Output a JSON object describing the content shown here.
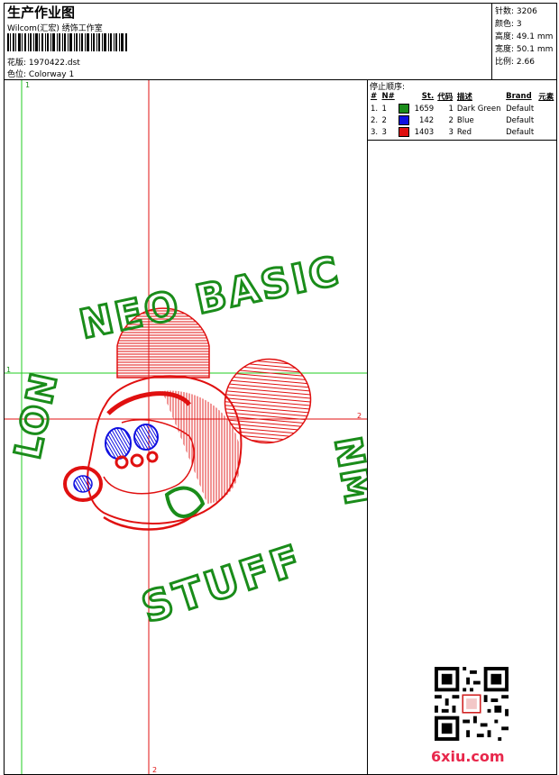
{
  "header": {
    "title": "生产作业图",
    "company": "Wilcom(汇宏) 绣饰工作室",
    "design_label": "花版:",
    "design_value": "1970422.dst",
    "colorway_label": "色位:",
    "colorway_value": "Colorway 1"
  },
  "stats": [
    {
      "label": "针数:",
      "value": "3206"
    },
    {
      "label": "颜色:",
      "value": "3"
    },
    {
      "label": "高度:",
      "value": "49.1 mm"
    },
    {
      "label": "宽度:",
      "value": "50.1 mm"
    },
    {
      "label": "比例:",
      "value": "2.66"
    }
  ],
  "stop_sequence": {
    "title": "停止顺序:",
    "columns": [
      "#",
      "N#",
      "St.",
      "代码",
      "描述",
      "Brand",
      "元素"
    ],
    "rows": [
      {
        "idx": "1.",
        "n": "1",
        "color": "#1a8c1a",
        "stitches": "1659",
        "code": "1",
        "desc": "Dark Green",
        "brand": "Default"
      },
      {
        "idx": "2.",
        "n": "2",
        "color": "#1010e0",
        "stitches": "142",
        "code": "2",
        "desc": "Blue",
        "brand": "Default"
      },
      {
        "idx": "3.",
        "n": "3",
        "color": "#e01010",
        "stitches": "1403",
        "code": "3",
        "desc": "Red",
        "brand": "Default"
      }
    ]
  },
  "guides": {
    "green_v": "1",
    "green_h": "1",
    "red_v": "2",
    "red_h": "2"
  },
  "embroidery_text": {
    "top": "NEO BASIC",
    "right": "NM",
    "bottom": "STUFF",
    "left": "LON"
  },
  "watermark": "6xiu.com",
  "colors": {
    "green": "#1a8c1a",
    "blue": "#1010e0",
    "red": "#e01010",
    "brand": "#e8274b"
  }
}
